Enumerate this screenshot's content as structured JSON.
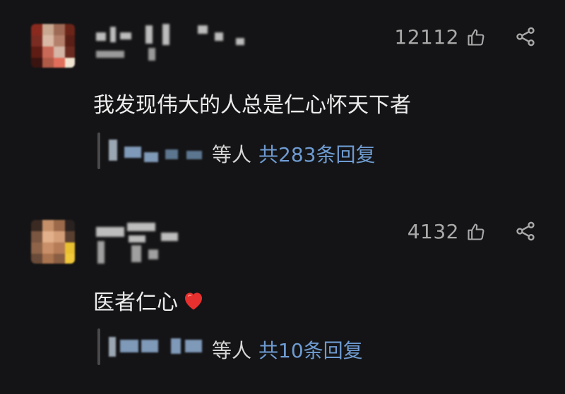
{
  "comments": [
    {
      "likes": "12112",
      "text": "我发现伟大的人总是仁心怀天下者",
      "reply_people": "等人",
      "reply_count": "共283条回复"
    },
    {
      "likes": "4132",
      "text": "医者仁心",
      "reply_people": "等人",
      "reply_count": "共10条回复"
    }
  ],
  "icons": {
    "like": "thumbs-up-icon",
    "share": "share-icon",
    "heart": "heart-emoji-icon"
  },
  "colors": {
    "background": "#141416",
    "text": "#ededed",
    "meta": "#a9a9a9",
    "link": "#6e9bd1",
    "heart": "#e8302f"
  }
}
